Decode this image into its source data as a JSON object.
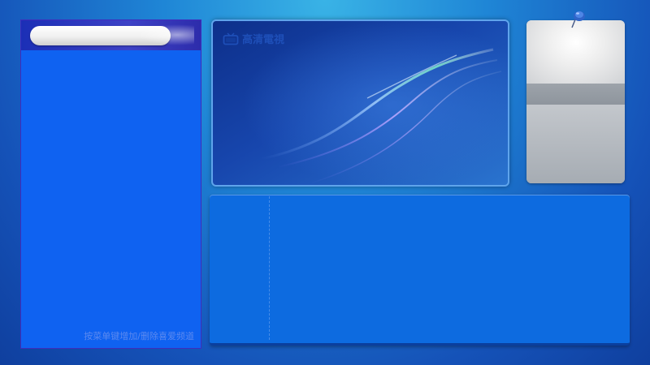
{
  "left_panel": {
    "search": {
      "value": "",
      "placeholder": ""
    },
    "hint": "按菜单键增加/删除喜爱频道"
  },
  "video": {
    "logo_text": "高清電視",
    "icon": "tv-icon"
  },
  "info_card": {
    "pin_icon": "pushpin-icon"
  },
  "colors": {
    "background": "#1f86d6",
    "panel_blue": "#0f62f1",
    "epg_blue": "#0d6be0",
    "card_gray": "#bfc3c8"
  }
}
